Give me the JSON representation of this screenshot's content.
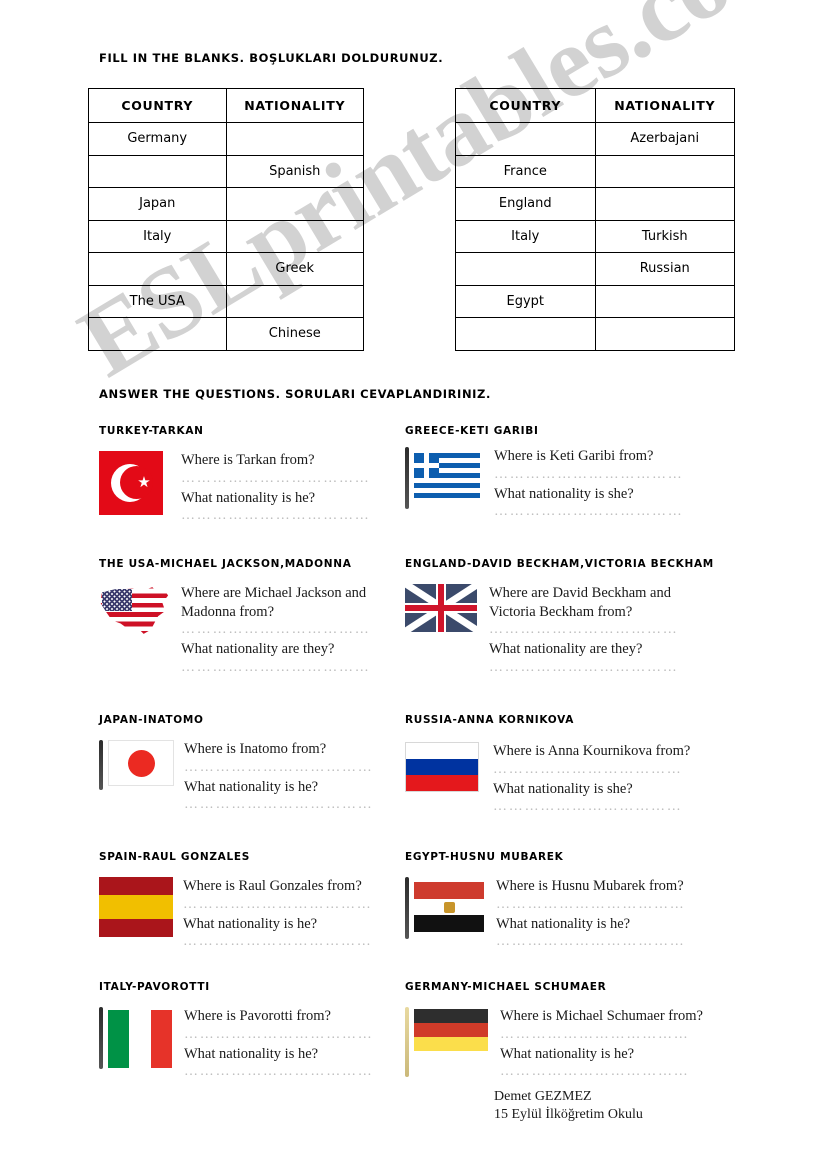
{
  "instructions": {
    "fill_in": "FILL IN THE BLANKS. BOŞLUKLARI DOLDURUNUZ.",
    "answer": "ANSWER THE QUESTIONS. SORULARI CEVAPLANDIRINIZ."
  },
  "watermark": {
    "text": "ESLprintables.com",
    "color": "#d2d2d2"
  },
  "tables": {
    "headers": [
      "COUNTRY",
      "NATIONALITY"
    ],
    "left": [
      {
        "country": "Germany",
        "nationality": ""
      },
      {
        "country": "",
        "nationality": "Spanish"
      },
      {
        "country": "Japan",
        "nationality": ""
      },
      {
        "country": "Italy",
        "nationality": ""
      },
      {
        "country": "",
        "nationality": "Greek"
      },
      {
        "country": "The USA",
        "nationality": ""
      },
      {
        "country": "",
        "nationality": "Chinese"
      }
    ],
    "right": [
      {
        "country": "",
        "nationality": "Azerbajani"
      },
      {
        "country": "France",
        "nationality": ""
      },
      {
        "country": "England",
        "nationality": ""
      },
      {
        "country": "Italy",
        "nationality": "Turkish"
      },
      {
        "country": "",
        "nationality": "Russian"
      },
      {
        "country": "Egypt",
        "nationality": ""
      },
      {
        "country": "",
        "nationality": ""
      }
    ]
  },
  "dots": "………………………………",
  "exercises": [
    {
      "heading": "TURKEY-TARKAN",
      "flag": "turkey-flag",
      "q1": "Where is Tarkan from?",
      "q2": "What nationality is he?"
    },
    {
      "heading": "GREECE-KETI GARIBI",
      "flag": "greece-flag",
      "q1": "Where is Keti Garibi from?",
      "q2": "What nationality is she?"
    },
    {
      "heading": "THE USA-MICHAEL JACKSON,MADONNA",
      "flag": "usa-flag",
      "q1": "Where are Michael Jackson and\nMadonna from?",
      "q2": "What nationality are they?"
    },
    {
      "heading": "ENGLAND-DAVID BECKHAM,VICTORIA BECKHAM",
      "flag": "united-kingdom-flag",
      "q1": "Where are David Beckham and\nVictoria Beckham from?",
      "q2": "What nationality are they?"
    },
    {
      "heading": "JAPAN-INATOMO",
      "flag": "japan-flag",
      "q1": "Where is Inatomo from?",
      "q2": "What nationality is he?"
    },
    {
      "heading": "RUSSIA-ANNA KORNIKOVA",
      "flag": "russia-flag",
      "q1": "Where is Anna Kournikova from?",
      "q2": "What nationality is she?"
    },
    {
      "heading": "SPAIN-RAUL GONZALES",
      "flag": "spain-flag",
      "q1": "Where is Raul Gonzales from?",
      "q2": "What nationality is he?"
    },
    {
      "heading": "EGYPT-HUSNU MUBAREK",
      "flag": "egypt-flag",
      "q1": "Where is Husnu Mubarek from?",
      "q2": "What nationality is he?"
    },
    {
      "heading": "ITALY-PAVOROTTI",
      "flag": "italy-flag",
      "q1": "Where is Pavorotti from?",
      "q2": "What nationality is he?"
    },
    {
      "heading": "GERMANY-MICHAEL SCHUMAER",
      "flag": "germany-flag",
      "q1": "Where is Michael Schumaer from?",
      "q2": "What nationality is he?"
    }
  ],
  "signature": "Demet GEZMEZ\n15 Eylül İlköğretim Okulu"
}
